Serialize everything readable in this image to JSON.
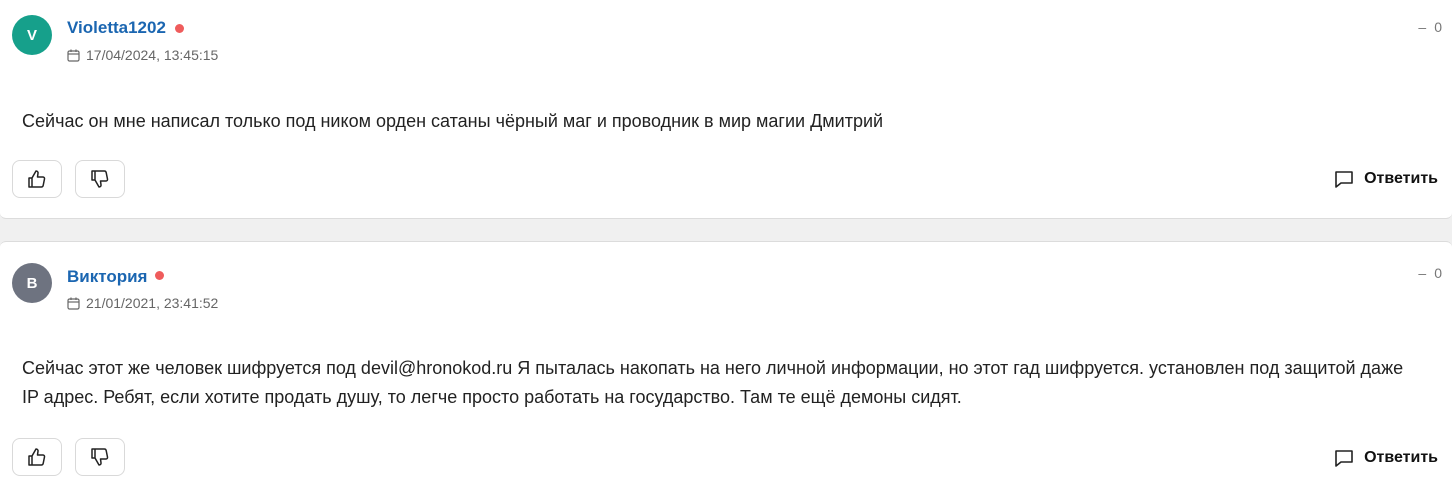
{
  "comments": [
    {
      "avatar_letter": "V",
      "author": "Violetta1202",
      "date": "17/04/2024, 13:45:15",
      "rating_sign": "–",
      "rating_value": "0",
      "text": "Сейчас он мне написал только под ником орден сатаны чёрный маг и проводник в мир магии Дмитрий",
      "reply_label": "Ответить"
    },
    {
      "avatar_letter": "В",
      "author": "Виктория",
      "date": "21/01/2021, 23:41:52",
      "rating_sign": "–",
      "rating_value": "0",
      "text": "Сейчас этот же человек шифруется под devil@hronokod.ru Я пыталась накопать на него личной информации, но этот гад шифруется. установлен под защитой даже IP адрес. Ребят, если хотите продать душу, то легче просто работать на государство. Там те ещё демоны сидят.",
      "reply_label": "Ответить"
    }
  ],
  "colors": {
    "avatar_1": "#16a08b",
    "avatar_2": "#6e7380",
    "author_link": "#1b66b1",
    "online_dot": "#ef5c5c"
  },
  "icons": [
    "calendar-icon",
    "thumbs-up-icon",
    "thumbs-down-icon",
    "comment-bubble-icon",
    "online-status-dot"
  ]
}
